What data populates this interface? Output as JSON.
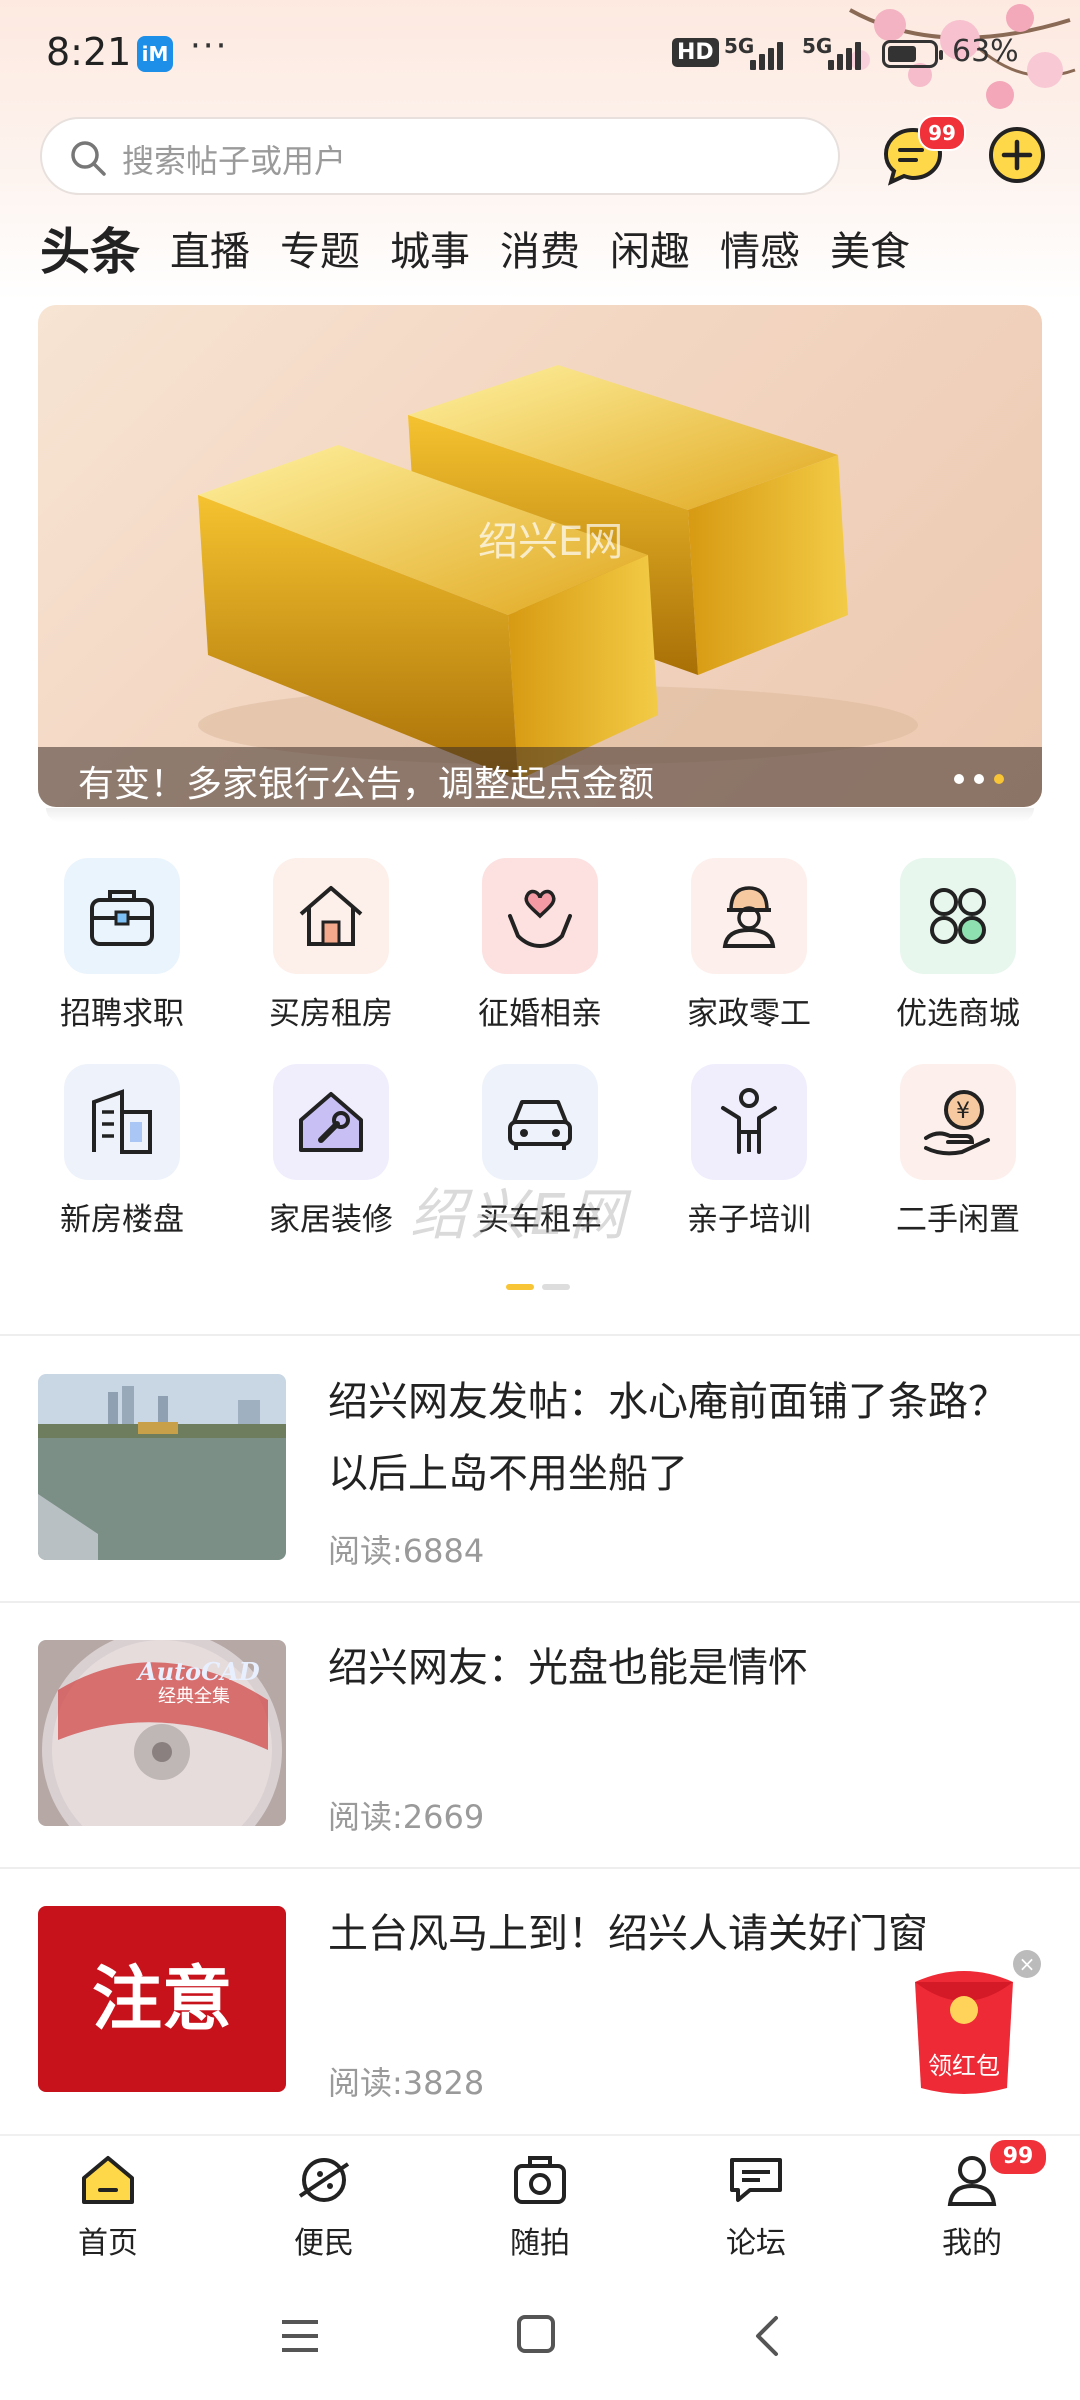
{
  "status_bar": {
    "time": "8:21",
    "app_badge": "iM",
    "more": "···",
    "hd": "HD",
    "net1": "5G",
    "net2": "5G",
    "battery_text": "63%",
    "battery_level": 0.63
  },
  "search": {
    "placeholder": "搜索帖子或用户"
  },
  "header": {
    "message_badge": "99"
  },
  "tabs": [
    {
      "label": "头条",
      "active": true
    },
    {
      "label": "直播"
    },
    {
      "label": "专题"
    },
    {
      "label": "城事"
    },
    {
      "label": "消费"
    },
    {
      "label": "闲趣"
    },
    {
      "label": "情感"
    },
    {
      "label": "美食"
    }
  ],
  "banner": {
    "caption": "有变！多家银行公告，调整起点金额",
    "watermark": "绍兴E网",
    "slide_count": 3,
    "active_slide": 3
  },
  "services": [
    {
      "label": "招聘求职",
      "icon": "briefcase-icon",
      "bg": "#eaf4fd"
    },
    {
      "label": "买房租房",
      "icon": "house-icon",
      "bg": "#fdefe9"
    },
    {
      "label": "征婚相亲",
      "icon": "heart-hands-icon",
      "bg": "#fde1e1"
    },
    {
      "label": "家政零工",
      "icon": "worker-icon",
      "bg": "#fdf0ec"
    },
    {
      "label": "优选商城",
      "icon": "clover-icon",
      "bg": "#e7f7ee"
    },
    {
      "label": "新房楼盘",
      "icon": "building-icon",
      "bg": "#eef3fb"
    },
    {
      "label": "家居装修",
      "icon": "wrench-house-icon",
      "bg": "#f0edfd"
    },
    {
      "label": "买车租车",
      "icon": "car-icon",
      "bg": "#eef3fb"
    },
    {
      "label": "亲子培训",
      "icon": "child-icon",
      "bg": "#f0edfd"
    },
    {
      "label": "二手闲置",
      "icon": "yuan-hand-icon",
      "bg": "#fdf0ec"
    }
  ],
  "services_watermark": "绍兴E网",
  "news": [
    {
      "title": "绍兴网友发帖：水心庵前面铺了条路？以后上岛不用坐船了",
      "meta": "阅读:6884",
      "thumb": "river-photo"
    },
    {
      "title": "绍兴网友：光盘也能是情怀",
      "meta": "阅读:2669",
      "thumb": "cd-photo"
    },
    {
      "title": "土台风马上到！绍兴人请关好门窗",
      "meta": "阅读:3828",
      "thumb": "notice-photo",
      "thumb_text": "注意"
    }
  ],
  "cd_text": {
    "brand": "AutoCAD",
    "sub": "经典全集"
  },
  "red_packet": {
    "label": "领红包",
    "close": "×"
  },
  "bottom_nav": [
    {
      "label": "首页",
      "icon": "home-icon",
      "active": true
    },
    {
      "label": "便民",
      "icon": "planet-icon"
    },
    {
      "label": "随拍",
      "icon": "camera-icon"
    },
    {
      "label": "论坛",
      "icon": "chat-icon"
    },
    {
      "label": "我的",
      "icon": "person-icon"
    }
  ],
  "bottom_nav_badge": "99",
  "colors": {
    "accent": "#f7c535",
    "badge": "#f0313a",
    "banner_dot_active": "#f7c535"
  }
}
